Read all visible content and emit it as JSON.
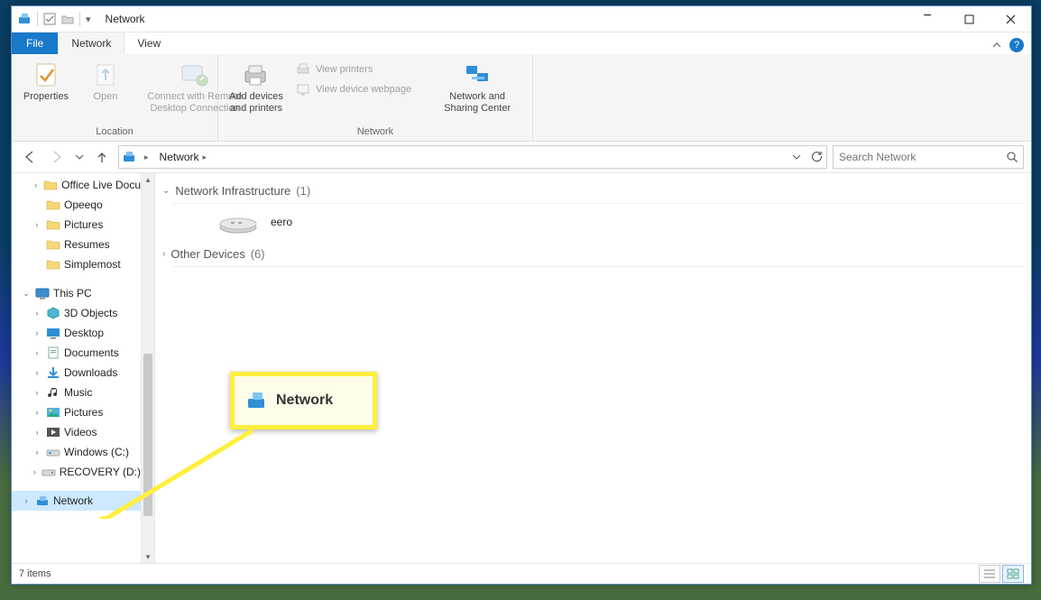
{
  "window": {
    "title": "Network",
    "min": "−",
    "max": "▢",
    "close": "✕"
  },
  "menutabs": {
    "file": "File",
    "network": "Network",
    "view": "View"
  },
  "ribbon": {
    "groups": {
      "location": {
        "label": "Location",
        "properties": "Properties",
        "open": "Open",
        "connect": "Connect with Remote\nDesktop Connection"
      },
      "network": {
        "label": "Network",
        "add_devices": "Add devices\nand printers",
        "view_printers": "View printers",
        "view_webpage": "View device webpage",
        "sharing_center": "Network and\nSharing Center"
      }
    }
  },
  "addressbar": {
    "location": "Network"
  },
  "search": {
    "placeholder": "Search Network"
  },
  "tree": {
    "top_items": [
      {
        "label": "Office Live Docu",
        "icon": "folder"
      },
      {
        "label": "Opeeqo",
        "icon": "folder"
      },
      {
        "label": "Pictures",
        "icon": "folder"
      },
      {
        "label": "Resumes",
        "icon": "folder"
      },
      {
        "label": "Simplemost",
        "icon": "folder"
      }
    ],
    "thispc": "This PC",
    "pc_items": [
      {
        "label": "3D Objects",
        "icon": "3d"
      },
      {
        "label": "Desktop",
        "icon": "desktop"
      },
      {
        "label": "Documents",
        "icon": "documents"
      },
      {
        "label": "Downloads",
        "icon": "downloads"
      },
      {
        "label": "Music",
        "icon": "music"
      },
      {
        "label": "Pictures",
        "icon": "pictures"
      },
      {
        "label": "Videos",
        "icon": "videos"
      },
      {
        "label": "Windows (C:)",
        "icon": "drive"
      },
      {
        "label": "RECOVERY (D:)",
        "icon": "drive"
      }
    ],
    "network": "Network"
  },
  "content": {
    "cat_infra": "Network Infrastructure",
    "cat_infra_count": "(1)",
    "eero": "eero",
    "cat_other": "Other Devices",
    "cat_other_count": "(6)"
  },
  "status": {
    "items": "7 items"
  },
  "callout": {
    "label": "Network"
  }
}
